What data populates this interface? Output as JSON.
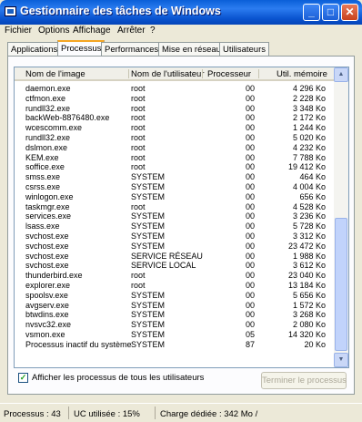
{
  "window": {
    "title": "Gestionnaire des tâches de Windows",
    "buttons": {
      "minimize": "_",
      "maximize": "□",
      "close": "✕"
    }
  },
  "menu": [
    "Fichier",
    "Options",
    "Affichage",
    "Arrêter",
    "?"
  ],
  "tabs": [
    "Applications",
    "Processus",
    "Performances",
    "Mise en réseau",
    "Utilisateurs"
  ],
  "active_tab": "Processus",
  "table": {
    "columns": [
      "Nom de l'image",
      "Nom de l'utilisateur",
      "Processeur",
      "Util. mémoire"
    ],
    "rows": [
      [
        "daemon.exe",
        "root",
        "00",
        "4 296 Ko"
      ],
      [
        "ctfmon.exe",
        "root",
        "00",
        "2 228 Ko"
      ],
      [
        "rundll32.exe",
        "root",
        "00",
        "3 348 Ko"
      ],
      [
        "backWeb-8876480.exe",
        "root",
        "00",
        "2 172 Ko"
      ],
      [
        "wcescomm.exe",
        "root",
        "00",
        "1 244 Ko"
      ],
      [
        "rundll32.exe",
        "root",
        "00",
        "5 020 Ko"
      ],
      [
        "dslmon.exe",
        "root",
        "00",
        "4 232 Ko"
      ],
      [
        "KEM.exe",
        "root",
        "00",
        "7 788 Ko"
      ],
      [
        "soffice.exe",
        "root",
        "00",
        "19 412 Ko"
      ],
      [
        "smss.exe",
        "SYSTEM",
        "00",
        "464 Ko"
      ],
      [
        "csrss.exe",
        "SYSTEM",
        "00",
        "4 004 Ko"
      ],
      [
        "winlogon.exe",
        "SYSTEM",
        "00",
        "656 Ko"
      ],
      [
        "taskmgr.exe",
        "root",
        "00",
        "4 528 Ko"
      ],
      [
        "services.exe",
        "SYSTEM",
        "00",
        "3 236 Ko"
      ],
      [
        "lsass.exe",
        "SYSTEM",
        "00",
        "5 728 Ko"
      ],
      [
        "svchost.exe",
        "SYSTEM",
        "00",
        "3 312 Ko"
      ],
      [
        "svchost.exe",
        "SYSTEM",
        "00",
        "23 472 Ko"
      ],
      [
        "svchost.exe",
        "SERVICE RÉSEAU",
        "00",
        "1 988 Ko"
      ],
      [
        "svchost.exe",
        "SERVICE LOCAL",
        "00",
        "3 612 Ko"
      ],
      [
        "thunderbird.exe",
        "root",
        "00",
        "23 040 Ko"
      ],
      [
        "explorer.exe",
        "root",
        "00",
        "13 184 Ko"
      ],
      [
        "spoolsv.exe",
        "SYSTEM",
        "00",
        "5 656 Ko"
      ],
      [
        "avgserv.exe",
        "SYSTEM",
        "00",
        "1 572 Ko"
      ],
      [
        "btwdins.exe",
        "SYSTEM",
        "00",
        "3 268 Ko"
      ],
      [
        "nvsvc32.exe",
        "SYSTEM",
        "00",
        "2 080 Ko"
      ],
      [
        "vsmon.exe",
        "SYSTEM",
        "05",
        "14 320 Ko"
      ],
      [
        "Processus inactif du système",
        "SYSTEM",
        "87",
        "20 Ko"
      ]
    ]
  },
  "show_all_users": {
    "label": "Afficher les processus de tous les utilisateurs",
    "checked": true
  },
  "end_process_button": "Terminer le processus",
  "status": {
    "processes": "Processus : 43",
    "cpu": "UC utilisée : 15%",
    "commit": "Charge dédiée : 342 Mo /"
  },
  "colors": {
    "title_bar": "#0a54d0",
    "active_tab_accent": "#f5a623",
    "window_bg": "#ece9d8"
  }
}
